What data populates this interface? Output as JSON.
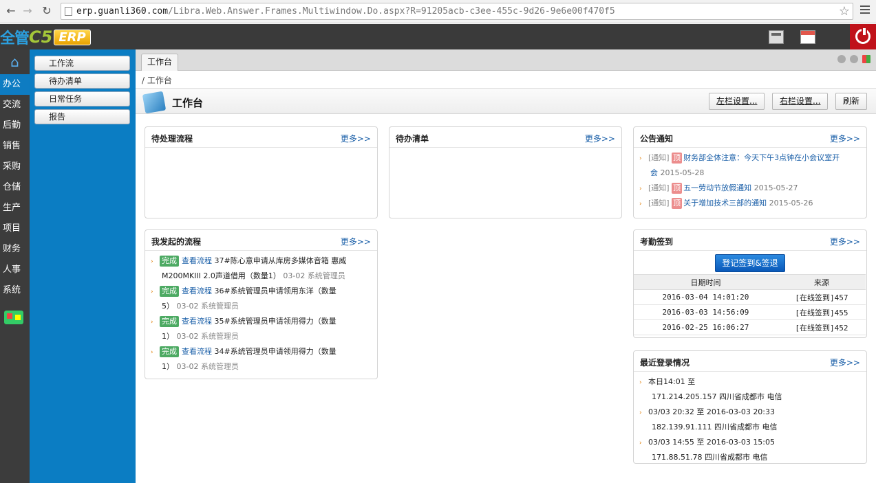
{
  "browser": {
    "url_host": "erp.guanli360.com",
    "url_path": "/Libra.Web.Answer.Frames.Multiwindow.Do.aspx?R=91205acb-c3ee-455c-9d26-9e6e00f470f5"
  },
  "logo": {
    "part_a": "全管",
    "part_b": "C5",
    "part_c": "ERP"
  },
  "leftnav": [
    "办公",
    "交流",
    "后勤",
    "销售",
    "采购",
    "仓储",
    "生产",
    "项目",
    "财务",
    "人事",
    "系统"
  ],
  "leftnav_active": "办公",
  "subnav": [
    "工作流",
    "待办清单",
    "日常任务",
    "报告"
  ],
  "tab": "工作台",
  "breadcrumb": "/ 工作台",
  "page_title": "工作台",
  "toolbar": {
    "left_setting": "左栏设置...",
    "right_setting": "右栏设置...",
    "refresh": "刷新"
  },
  "more_label": "更多>>",
  "panels": {
    "pending_flow": {
      "title": "待处理流程"
    },
    "todo": {
      "title": "待办清单"
    },
    "notice": {
      "title": "公告通知",
      "items": [
        {
          "type": "[通知]",
          "tag": "顶",
          "title": "财务部全体注意：今天下午3点钟在小会议室开",
          "title2": "会",
          "date": "2015-05-28"
        },
        {
          "type": "[通知]",
          "tag": "顶",
          "title": "五一劳动节放假通知",
          "date": "2015-05-27"
        },
        {
          "type": "[通知]",
          "tag": "顶",
          "title": "关于增加技术三部的通知",
          "date": "2015-05-26"
        }
      ]
    },
    "my_flow": {
      "title": "我发起的流程",
      "items": [
        {
          "status": "完成",
          "link": "查看流程",
          "text": "37#陈心意申请从库房多媒体音箱 惠威",
          "text2": "M200MKIII 2.0声道借用（数量1）",
          "date": "03-02",
          "user": "系统管理员"
        },
        {
          "status": "完成",
          "link": "查看流程",
          "text": "36#系统管理员申请领用东洋（数量",
          "text2": "5）",
          "date": "03-02",
          "user": "系统管理员"
        },
        {
          "status": "完成",
          "link": "查看流程",
          "text": "35#系统管理员申请领用得力（数量",
          "text2": "1）",
          "date": "03-02",
          "user": "系统管理员"
        },
        {
          "status": "完成",
          "link": "查看流程",
          "text": "34#系统管理员申请领用得力（数量",
          "text2": "1）",
          "date": "03-02",
          "user": "系统管理员"
        }
      ]
    },
    "attendance": {
      "title": "考勤签到",
      "button": "登记签到&签退",
      "headers": [
        "日期时间",
        "来源"
      ],
      "rows": [
        [
          "2016-03-04 14:01:20",
          "[在线签到]457"
        ],
        [
          "2016-03-03 14:56:09",
          "[在线签到]455"
        ],
        [
          "2016-02-25 16:06:27",
          "[在线签到]452"
        ]
      ]
    },
    "login": {
      "title": "最近登录情况",
      "items": [
        {
          "line1": "本日14:01 至",
          "line2": "171.214.205.157 四川省成都市 电信"
        },
        {
          "line1": "03/03 20:32 至 2016-03-03 20:33",
          "line2": "182.139.91.111 四川省成都市 电信"
        },
        {
          "line1": "03/03 14:55 至 2016-03-03 15:05",
          "line2": "171.88.51.78 四川省成都市 电信"
        }
      ]
    }
  }
}
